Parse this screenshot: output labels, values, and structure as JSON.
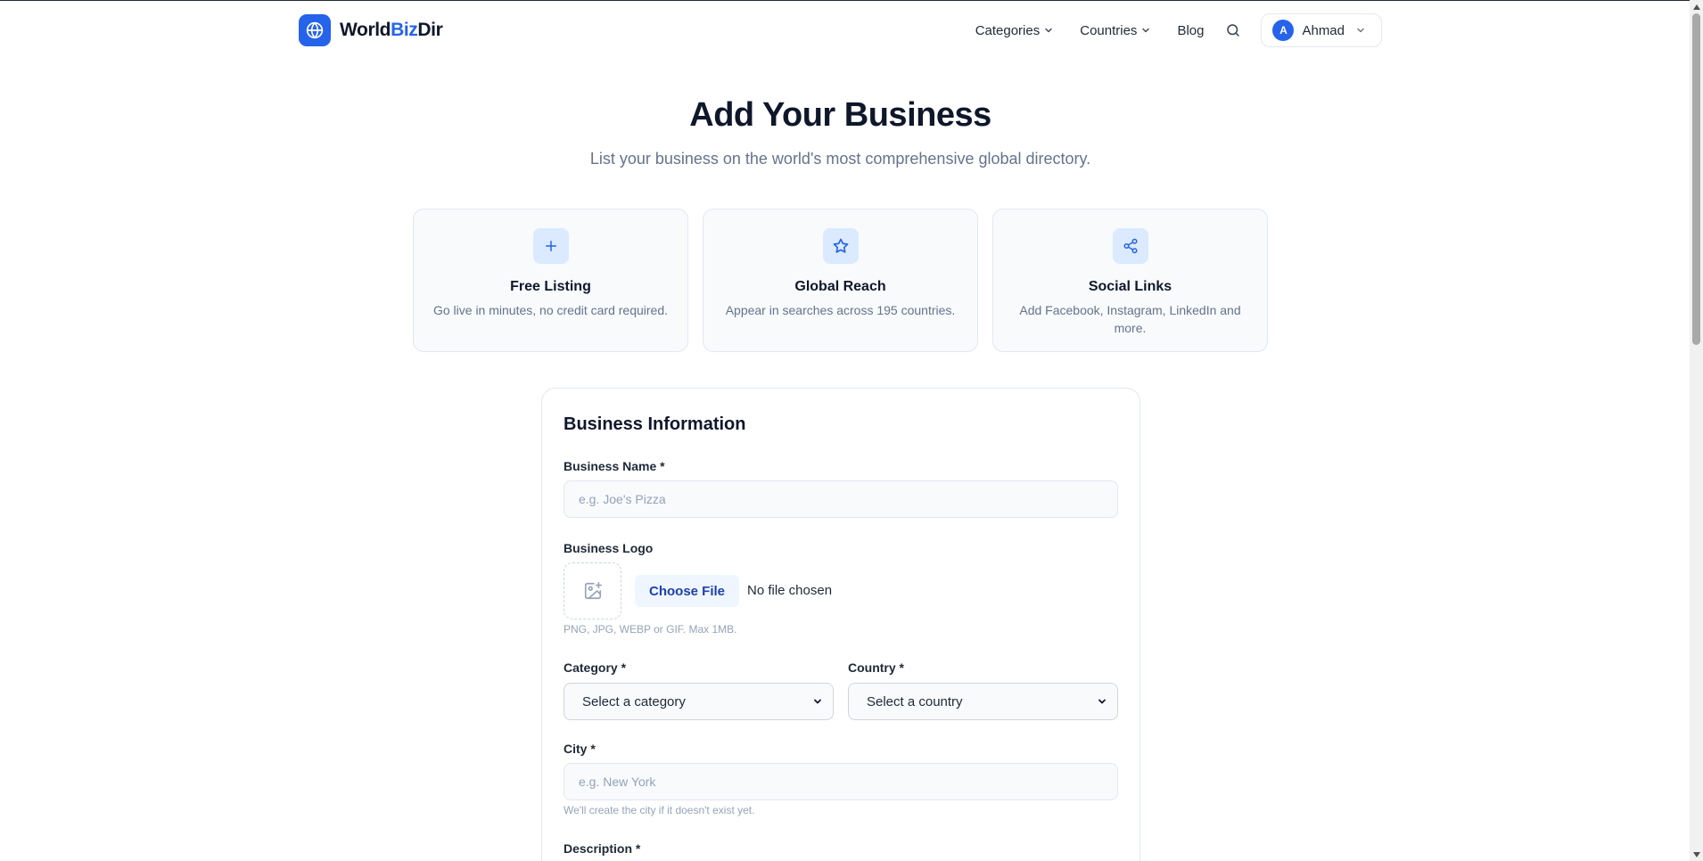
{
  "brand": {
    "name_part1": "World",
    "name_part2": "Biz",
    "name_part3": "Dir",
    "icon": "globe-icon",
    "color": "#2563eb"
  },
  "nav": {
    "categories_label": "Categories",
    "countries_label": "Countries",
    "blog_label": "Blog",
    "search_icon": "search-icon",
    "user_initial": "A",
    "user_name": "Ahmad"
  },
  "hero": {
    "title": "Add Your Business",
    "subtitle": "List your business on the world's most comprehensive global directory."
  },
  "features": [
    {
      "icon": "plus-icon",
      "title": "Free Listing",
      "description": "Go live in minutes, no credit card required."
    },
    {
      "icon": "star-icon",
      "title": "Global Reach",
      "description": "Appear in searches across 195 countries."
    },
    {
      "icon": "share-icon",
      "title": "Social Links",
      "description": "Add Facebook, Instagram, LinkedIn and more."
    }
  ],
  "form": {
    "title": "Business Information",
    "business_name_label": "Business Name *",
    "business_name_placeholder": "e.g. Joe's Pizza",
    "business_name_value": "",
    "logo_label": "Business Logo",
    "choose_file_label": "Choose File",
    "no_file_text": "No file chosen",
    "logo_hint": "PNG, JPG, WEBP or GIF. Max 1MB.",
    "category_label": "Category *",
    "category_selected": "Select a category",
    "country_label": "Country *",
    "country_selected": "Select a country",
    "city_label": "City *",
    "city_placeholder": "e.g. New York",
    "city_value": "",
    "city_hint": "We'll create the city if it doesn't exist yet.",
    "description_label": "Description *"
  },
  "colors": {
    "accent": "#2563eb",
    "text": "#0f172a",
    "muted": "#64748b",
    "card_bg": "#f8fafc",
    "border": "#e2e8f0"
  }
}
